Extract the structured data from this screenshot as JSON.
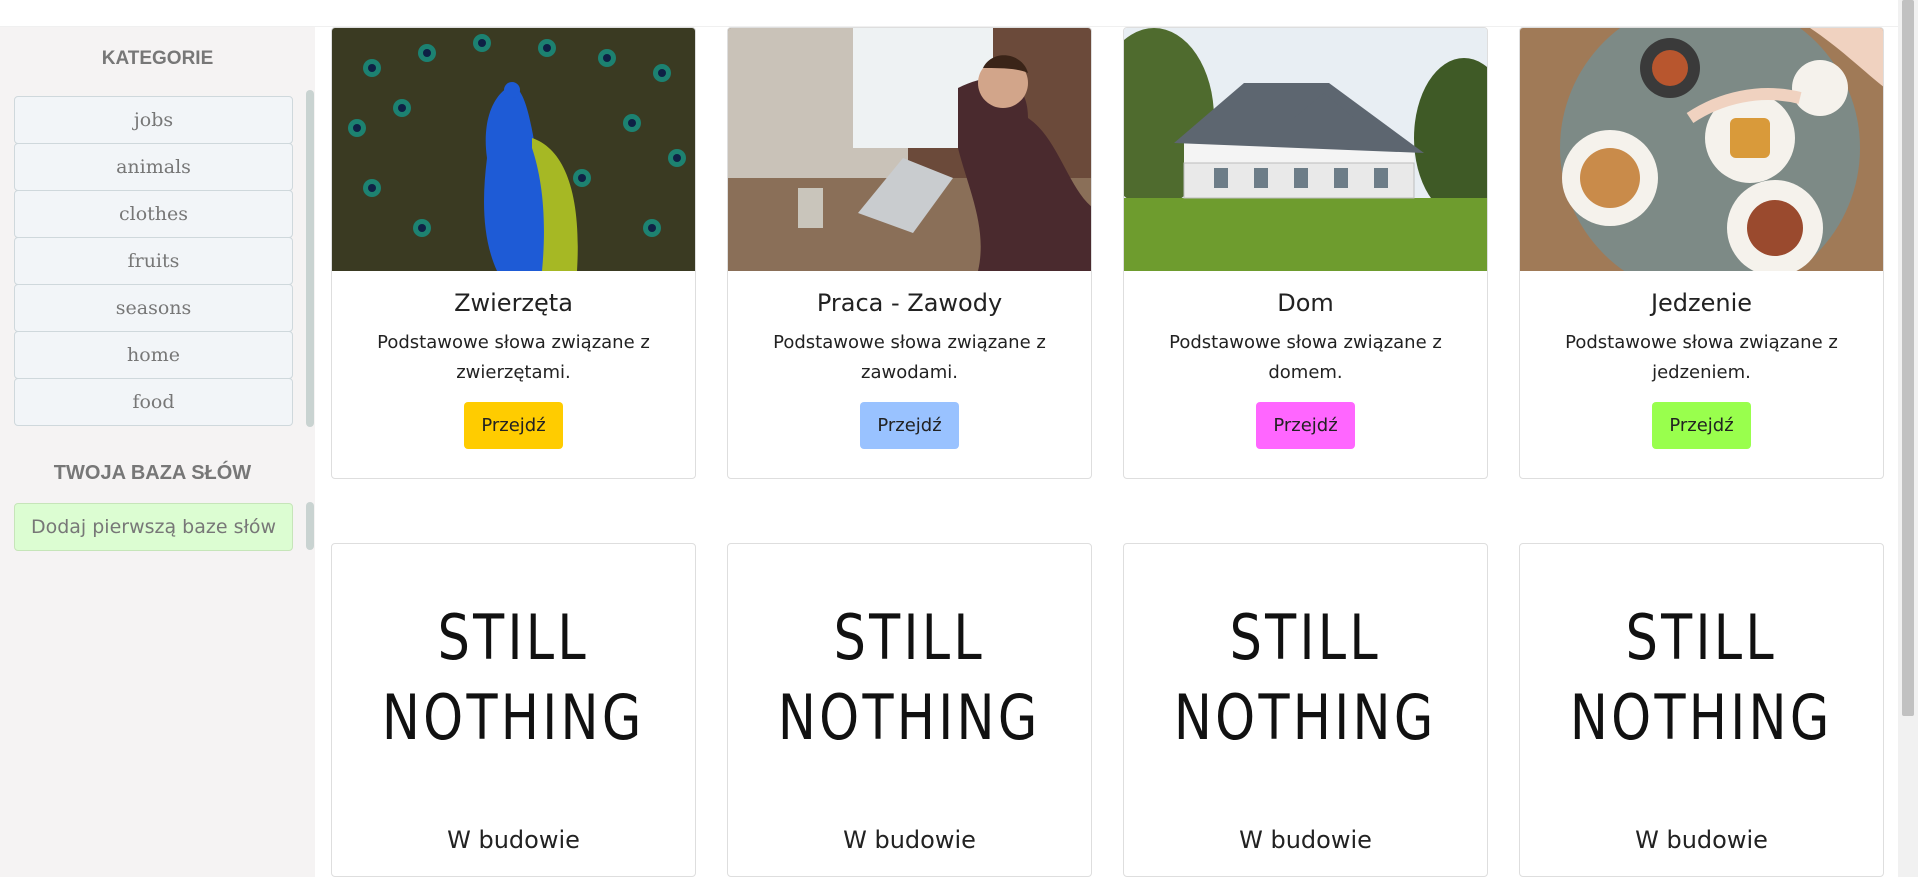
{
  "sidebar": {
    "categories_title": "KATEGORIE",
    "categories": [
      "jobs",
      "animals",
      "clothes",
      "fruits",
      "seasons",
      "home",
      "food"
    ],
    "wordbase_title": "TWOJA BAZA SŁÓW",
    "add_wordbase_label": "Dodaj pierwszą baze słów"
  },
  "cards": [
    {
      "title": "Zwierzęta",
      "text": "Podstawowe słowa związane z zwierzętami.",
      "button": "Przejdź",
      "button_color": "#ffcc00",
      "image": "peacock-photo"
    },
    {
      "title": "Praca - Zawody",
      "text": "Podstawowe słowa związane z zawodami.",
      "button": "Przejdź",
      "button_color": "#99c2ff",
      "image": "person-laptop-photo"
    },
    {
      "title": "Dom",
      "text": "Podstawowe słowa związane z domem.",
      "button": "Przejdź",
      "button_color": "#ff66ff",
      "image": "house-photo"
    },
    {
      "title": "Jedzenie",
      "text": "Podstawowe słowa związane z jedzeniem.",
      "button": "Przejdź",
      "button_color": "#99ff4d",
      "image": "food-table-photo"
    }
  ],
  "placeholder_cards": [
    {
      "image_line1": "STILL",
      "image_line2": "NOTHING",
      "title": "W budowie"
    },
    {
      "image_line1": "STILL",
      "image_line2": "NOTHING",
      "title": "W budowie"
    },
    {
      "image_line1": "STILL",
      "image_line2": "NOTHING",
      "title": "W budowie"
    },
    {
      "image_line1": "STILL",
      "image_line2": "NOTHING",
      "title": "W budowie"
    }
  ]
}
